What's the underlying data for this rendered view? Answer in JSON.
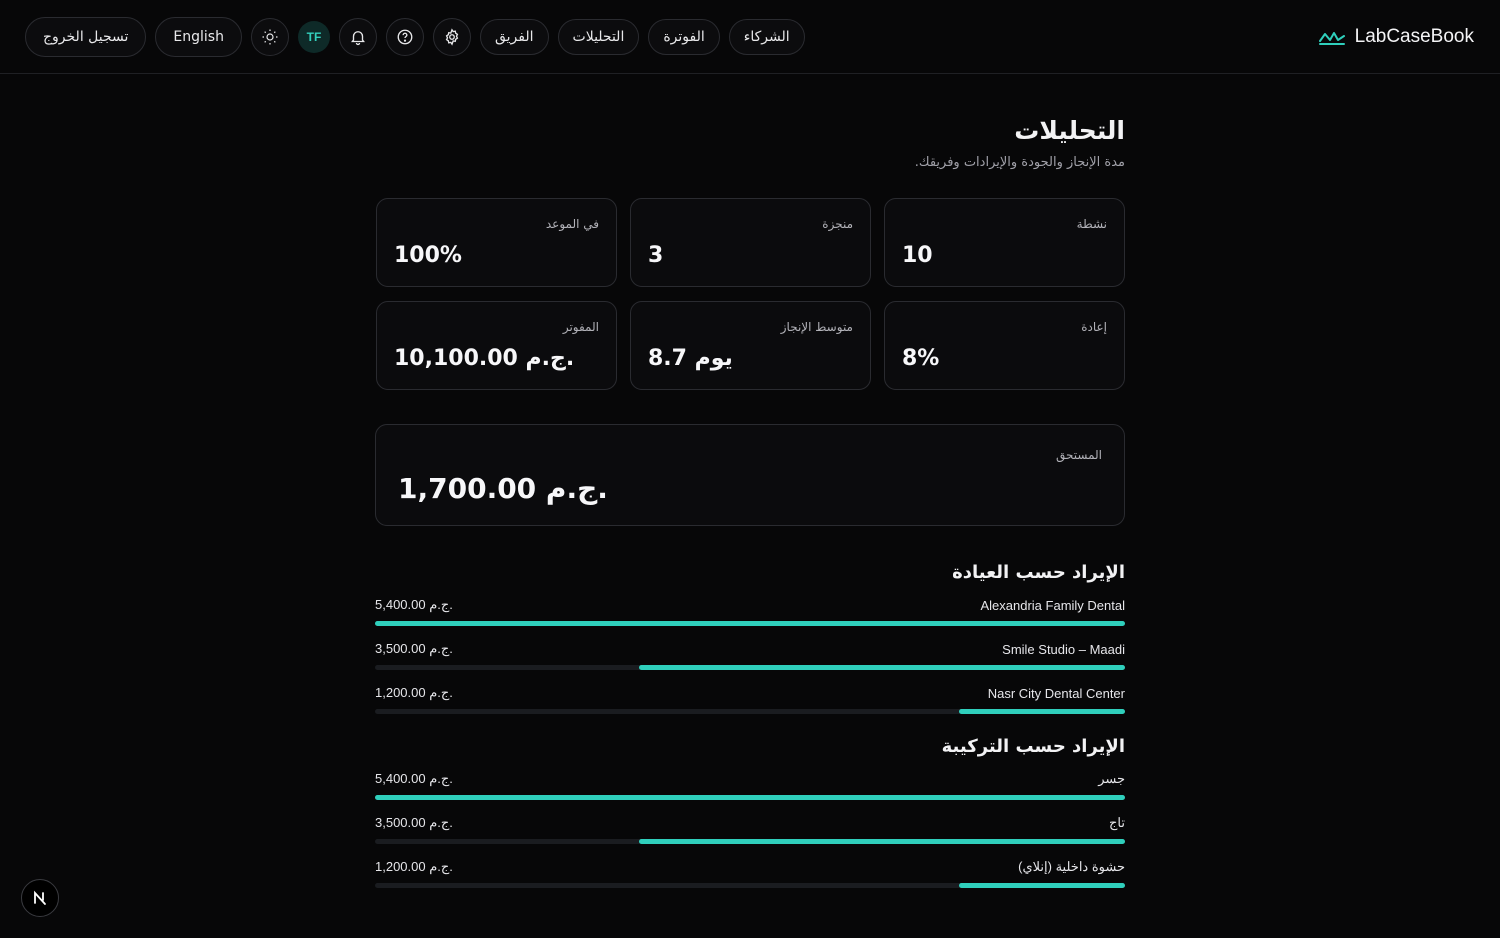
{
  "header": {
    "brand": "LabCaseBook",
    "nav": [
      "الشركاء",
      "الفوترة",
      "التحليلات",
      "الفريق"
    ],
    "avatar_initials": "TF",
    "language_label": "English",
    "logout_label": "تسجيل الخروج"
  },
  "page": {
    "title": "التحليلات",
    "subtitle": "مدة الإنجاز والجودة والإيرادات وفريقك."
  },
  "stats": [
    {
      "label": "نشطة",
      "value": "10"
    },
    {
      "label": "منجزة",
      "value": "3"
    },
    {
      "label": "في الموعد",
      "value": "100%"
    },
    {
      "label": "إعادة",
      "value": "8%"
    },
    {
      "label": "متوسط الإنجاز",
      "value": "8.7 يوم"
    },
    {
      "label": "المفوتر",
      "value": "10,100.00 ج.م."
    }
  ],
  "due": {
    "label": "المستحق",
    "value": "1,700.00 ج.م."
  },
  "revenue_by_clinic": {
    "title": "الإيراد حسب العيادة",
    "rows": [
      {
        "name": "Alexandria Family Dental",
        "amount": "5,400.00 ج.م.",
        "share": 1.0
      },
      {
        "name": "Smile Studio – Maadi",
        "amount": "3,500.00 ج.م.",
        "share": 0.648
      },
      {
        "name": "Nasr City Dental Center",
        "amount": "1,200.00 ج.م.",
        "share": 0.222
      }
    ]
  },
  "revenue_by_type": {
    "title": "الإيراد حسب التركيبة",
    "rows": [
      {
        "name": "جسر",
        "amount": "5,400.00 ج.م.",
        "share": 1.0
      },
      {
        "name": "تاج",
        "amount": "3,500.00 ج.م.",
        "share": 0.648
      },
      {
        "name": "حشوة داخلية (إنلاي)",
        "amount": "1,200.00 ج.م.",
        "share": 0.222
      }
    ]
  },
  "colors": {
    "accent": "#2fcfbc",
    "background": "#070708",
    "card": "#0b0b0d"
  }
}
